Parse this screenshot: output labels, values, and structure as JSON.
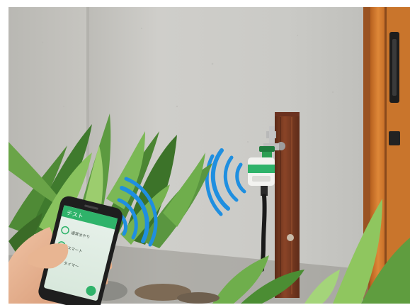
{
  "photo": {
    "subject": "smart-water-timer-controlled-by-smartphone",
    "colors": {
      "wall": "#c9c8c3",
      "wall_shadow": "#a9a9a5",
      "door_orange": "#d2782a",
      "post_brown": "#7a3b22",
      "signal_blue": "#1f8fe0",
      "app_green": "#2fb36a",
      "leaf_green": "#4e8e3a"
    },
    "phone_screen": {
      "header_text": "テスト",
      "row_labels": [
        "通常水やり",
        "スマート",
        "タイマー"
      ]
    }
  }
}
